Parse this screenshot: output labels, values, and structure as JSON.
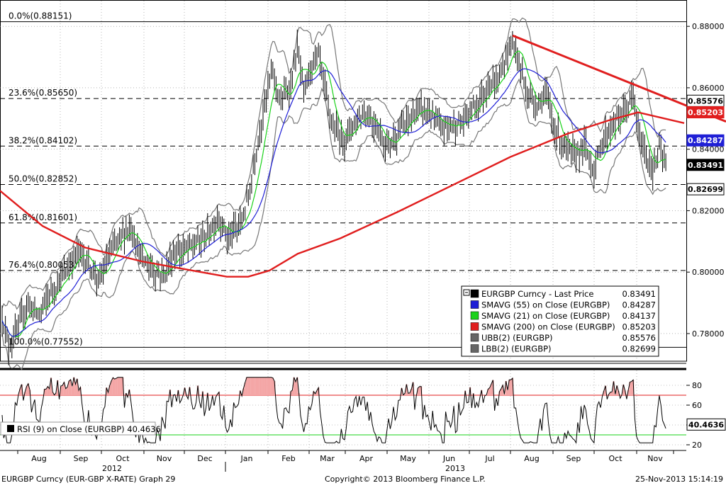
{
  "chart_data": {
    "type": "line",
    "title": "EURGBP Curncy (EUR-GBP X-RATE) Graph 29",
    "price_panel": {
      "ylim": [
        0.771,
        0.8835
      ],
      "ticks": [
        0.78,
        0.8,
        0.82,
        0.84,
        0.86,
        0.88
      ],
      "tick_labels": [
        "0.78000",
        "0.80000",
        "0.82000",
        "0.84000",
        "0.86000",
        "0.88000"
      ],
      "series": [
        {
          "name": "EURGBP Curncy - Last Price",
          "value": "0.83491",
          "color": "#000000"
        },
        {
          "name": "SMAVG (55) on Close (EURGBP)",
          "value": "0.84287",
          "color": "#1f1fd6"
        },
        {
          "name": "SMAVG (21) on Close (EURGBP)",
          "value": "0.84137",
          "color": "#19d219"
        },
        {
          "name": "SMAVG (200) on Close (EURGBP)",
          "value": "0.85203",
          "color": "#e01e1e"
        },
        {
          "name": "UBB(2) (EURGBP)",
          "value": "0.85576",
          "color": "#666666"
        },
        {
          "name": "LBB(2) (EURGBP)",
          "value": "0.82699",
          "color": "#666666"
        }
      ],
      "fib_levels": [
        {
          "label": "0.0%(0.88151)",
          "value": 0.88151
        },
        {
          "label": "23.6%(0.85650)",
          "value": 0.8565
        },
        {
          "label": "38.2%(0.84102)",
          "value": 0.84102
        },
        {
          "label": "50.0%(0.82852)",
          "value": 0.82852
        },
        {
          "label": "61.8%(0.81601)",
          "value": 0.81601
        },
        {
          "label": "76.4%(0.80053)",
          "value": 0.80053
        },
        {
          "label": "100.0%(0.77552)",
          "value": 0.77552
        }
      ],
      "right_tags": [
        {
          "text": "0.85576",
          "value": 0.85576,
          "bg": "#ffffff",
          "fg": "#000000"
        },
        {
          "text": "0.85203",
          "value": 0.85203,
          "bg": "#e01e1e",
          "fg": "#ffffff"
        },
        {
          "text": "0.84287",
          "value": 0.84287,
          "bg": "#1f1fd6",
          "fg": "#ffffff"
        },
        {
          "text": "0.83491",
          "value": 0.83491,
          "bg": "#000000",
          "fg": "#ffffff"
        },
        {
          "text": "0.82699",
          "value": 0.82699,
          "bg": "#ffffff",
          "fg": "#000000"
        }
      ],
      "trendline": {
        "from": [
          "Jul 2013",
          0.877
        ],
        "to": [
          "Nov 2013",
          0.852
        ]
      },
      "legend_position": "bottom-right"
    },
    "rsi_panel": {
      "legend": "RSI (9) on Close (EURGBP)",
      "value": "40.4636",
      "ylim": [
        15,
        95
      ],
      "ticks": [
        20,
        40,
        60,
        80
      ],
      "tick_labels": [
        "20",
        "40",
        "60",
        "80"
      ],
      "upper_band": 70,
      "lower_band": 30
    },
    "x_axis": {
      "months": [
        "Aug",
        "Sep",
        "Oct",
        "Nov",
        "Dec",
        "Jan",
        "Feb",
        "Mar",
        "Apr",
        "May",
        "Jun",
        "Jul",
        "Aug",
        "Sep",
        "Oct",
        "Nov"
      ],
      "years": [
        "2012",
        "2013"
      ]
    }
  },
  "footer": {
    "left": "EURGBP Curncy (EUR-GBP X-RATE) Graph 29",
    "center": "Copyright© 2013 Bloomberg Finance L.P.",
    "right": "25-Nov-2013 15:14:19"
  },
  "icons": {
    "legend_toggle": "collapse-box-icon"
  }
}
